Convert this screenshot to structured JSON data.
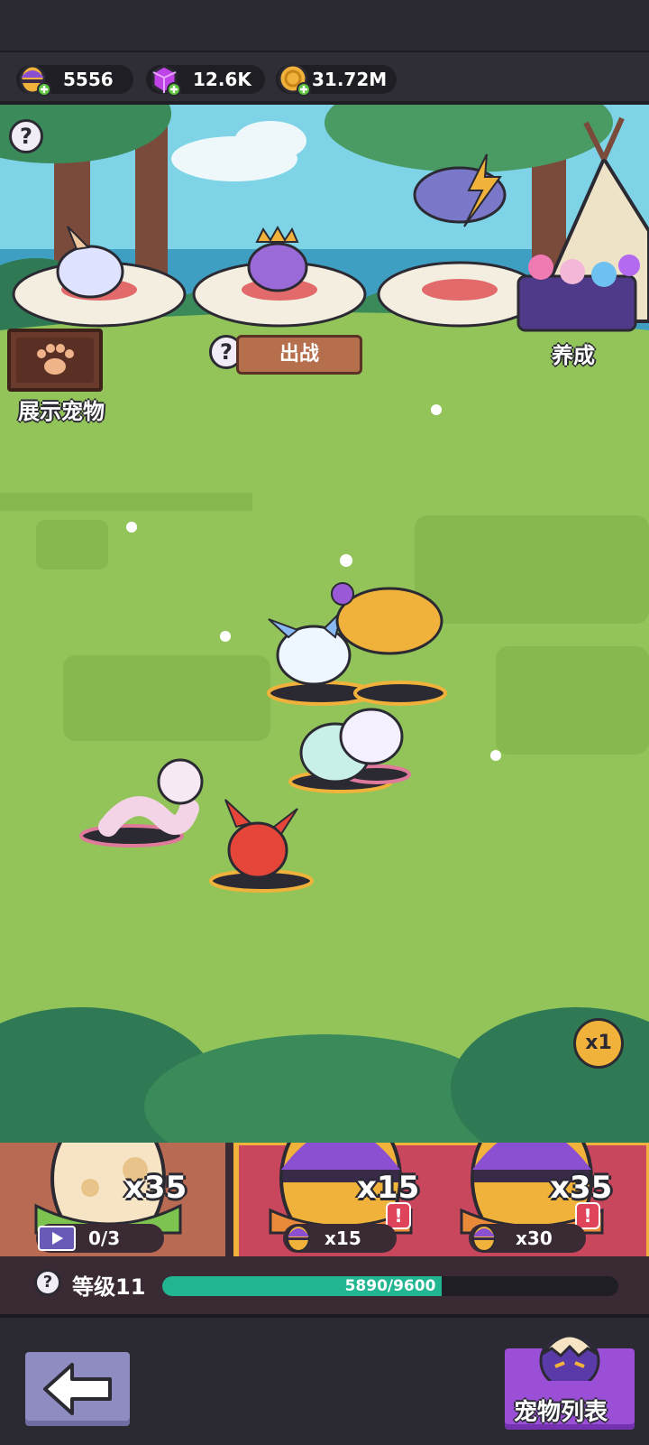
{
  "resources": {
    "purple_egg": "5556",
    "gems": "12.6K",
    "coins": "31.72M"
  },
  "scene": {
    "showcase_label": "展示宠物",
    "battle_label": "出战",
    "train_label": "养成"
  },
  "eggs": [
    {
      "count": "x35",
      "ad_progress": "0/3"
    },
    {
      "count": "x15",
      "cost": "x15"
    },
    {
      "count": "x35",
      "cost": "x30"
    }
  ],
  "multiplier_badge": "x1",
  "level": {
    "label": "等级11",
    "xp_text": "5890/9600",
    "xp_current": 5890,
    "xp_max": 9600
  },
  "footer": {
    "pet_list_label": "宠物列表"
  },
  "colors": {
    "grass": "#93c45a",
    "accent_green": "#22b592",
    "purple": "#8b4fd1",
    "gold": "#f0b23a"
  }
}
